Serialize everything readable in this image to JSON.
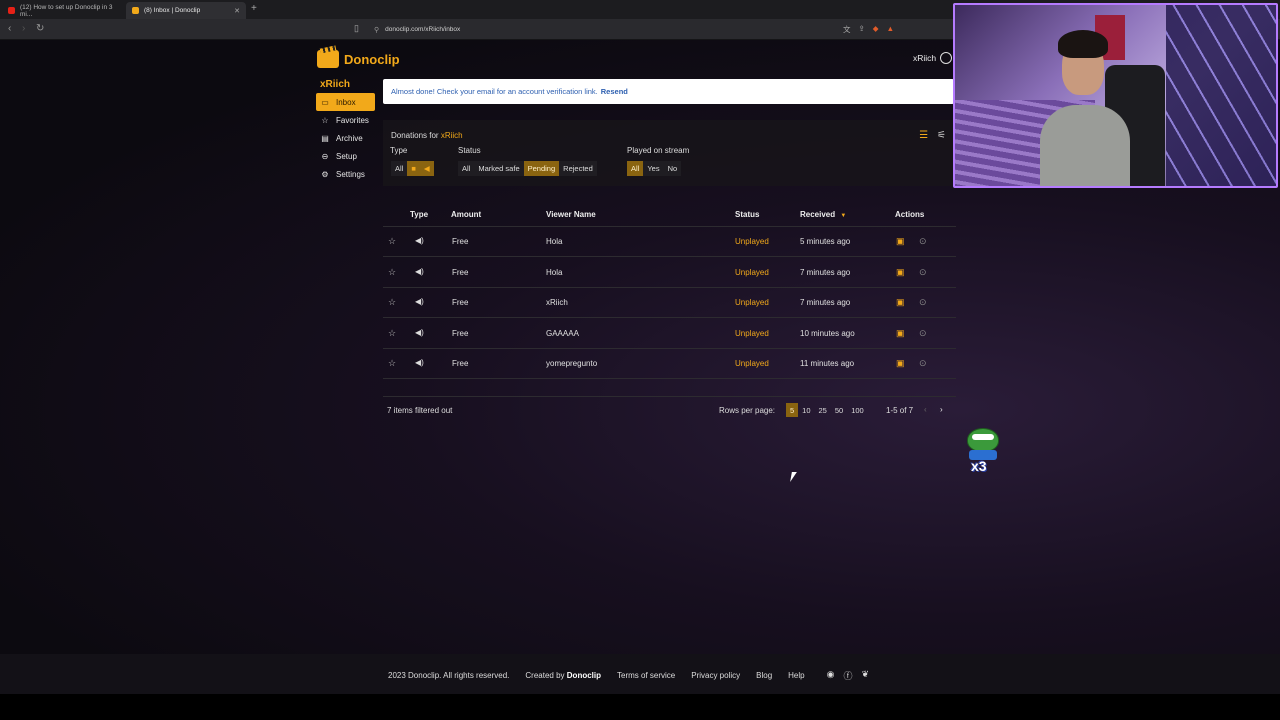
{
  "browser": {
    "tabs": [
      {
        "title": "(12) How to set up Donoclip in 3 mi...",
        "active": false,
        "favicon_color": "#e62117"
      },
      {
        "title": "(8) Inbox | Donoclip",
        "active": true,
        "favicon_color": "#f2a91a"
      }
    ],
    "url": "donoclip.com/xRiich/inbox"
  },
  "app": {
    "brand": "Donoclip",
    "accent_color": "#f2a91a",
    "header_user": "xRiich",
    "sidebar_user": "xRiich",
    "sidebar": [
      {
        "label": "Inbox",
        "icon": "inbox-icon",
        "active": true
      },
      {
        "label": "Favorites",
        "icon": "star-icon",
        "active": false
      },
      {
        "label": "Archive",
        "icon": "archive-icon",
        "active": false
      },
      {
        "label": "Setup",
        "icon": "link-icon",
        "active": false
      },
      {
        "label": "Settings",
        "icon": "gear-icon",
        "active": false
      }
    ],
    "banner": {
      "text": "Almost done! Check your email for an account verification link.",
      "link": "Resend"
    }
  },
  "filters": {
    "donations_for_label": "Donations for",
    "donations_for_user": "xRiich",
    "type": {
      "label": "Type",
      "options": [
        "All"
      ],
      "icons": [
        "video-icon",
        "audio-icon"
      ]
    },
    "status": {
      "label": "Status",
      "options": [
        "All",
        "Marked safe",
        "Pending",
        "Rejected"
      ],
      "selected": "Pending"
    },
    "played": {
      "label": "Played on stream",
      "options": [
        "All",
        "Yes",
        "No"
      ],
      "selected": "All"
    }
  },
  "table": {
    "columns": [
      "Type",
      "Amount",
      "Viewer Name",
      "Status",
      "Received",
      "Actions"
    ],
    "sort_column": "Received",
    "rows": [
      {
        "amount": "Free",
        "viewer": "Hola",
        "status": "Unplayed",
        "received": "5 minutes ago"
      },
      {
        "amount": "Free",
        "viewer": "Hola",
        "status": "Unplayed",
        "received": "7 minutes ago"
      },
      {
        "amount": "Free",
        "viewer": "xRiich",
        "status": "Unplayed",
        "received": "7 minutes ago"
      },
      {
        "amount": "Free",
        "viewer": "GAAAAA",
        "status": "Unplayed",
        "received": "10 minutes ago"
      },
      {
        "amount": "Free",
        "viewer": "yomepregunto",
        "status": "Unplayed",
        "received": "11 minutes ago"
      }
    ],
    "filtered_out": "7 items filtered out",
    "rows_per_page_label": "Rows per page:",
    "rows_per_page_options": [
      "5",
      "10",
      "25",
      "50",
      "100"
    ],
    "rows_per_page_selected": "5",
    "range": "1-5 of 7"
  },
  "footer": {
    "copyright": "2023 Donoclip. All rights reserved.",
    "created_by_label": "Created by",
    "created_by": "Donoclip",
    "links": [
      "Terms of service",
      "Privacy policy",
      "Blog",
      "Help"
    ]
  }
}
